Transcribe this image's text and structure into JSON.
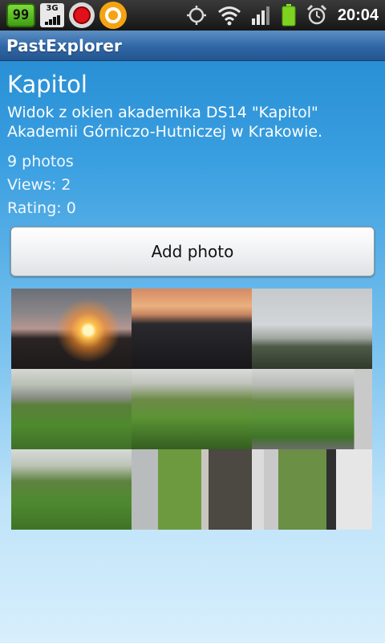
{
  "status_bar": {
    "badge_number": "99",
    "badge_3g": "3G",
    "time": "20:04",
    "icons": [
      "app-99-icon",
      "3g-signal-icon",
      "record-icon",
      "orange-app-icon",
      "gps-icon",
      "wifi-icon",
      "cell-signal-icon",
      "battery-icon",
      "alarm-icon"
    ]
  },
  "app": {
    "title": "PastExplorer"
  },
  "place": {
    "title": "Kapitol",
    "description": "Widok z okien akademika DS14 \"Kapitol\" Akademii Górniczo-Hutniczej w Krakowie.",
    "photos": "9 photos",
    "views": "Views: 2",
    "rating": "Rating: 0"
  },
  "actions": {
    "add_photo": "Add photo"
  },
  "photo_grid": {
    "count": 9
  },
  "colors": {
    "title_bar": "#2f66a6",
    "background_top": "#1f87cf",
    "background_bottom": "#d8effc"
  }
}
